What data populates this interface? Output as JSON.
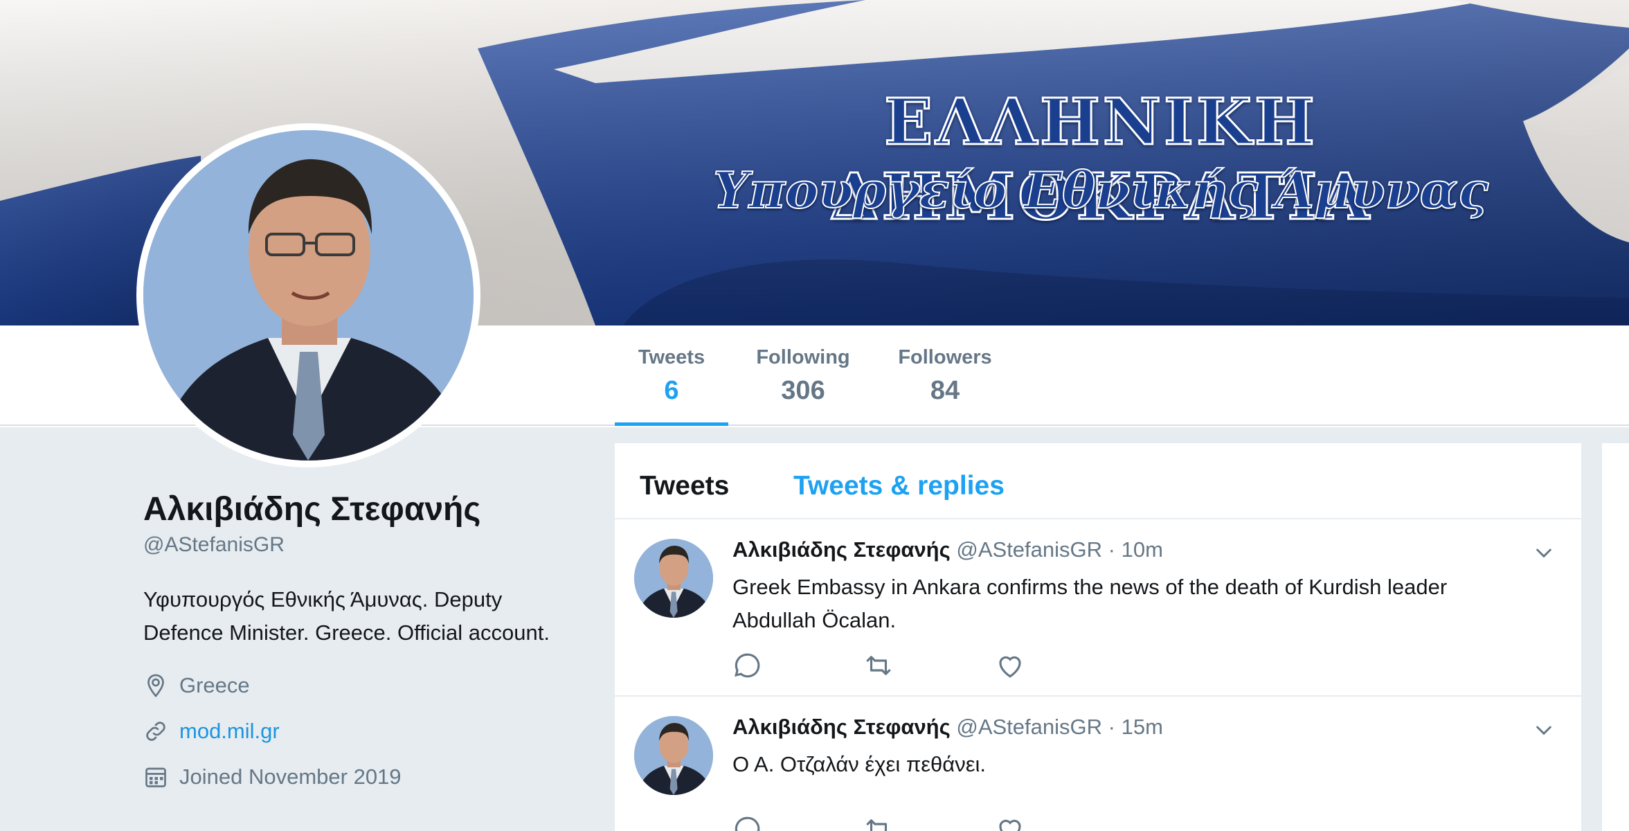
{
  "banner": {
    "title": "ΕΛΛΗΝΙΚΗ ΔΗΜΟΚΡΑΤΙΑ",
    "subtitle": "Υπουργείο Εθνικής Άμυνας",
    "flag_blue": "#1c3e8e"
  },
  "stats": [
    {
      "label": "Tweets",
      "value": "6",
      "active": true
    },
    {
      "label": "Following",
      "value": "306",
      "active": false
    },
    {
      "label": "Followers",
      "value": "84",
      "active": false
    }
  ],
  "profile": {
    "name": "Αλκιβιάδης Στεφανής",
    "handle": "@AStefanisGR",
    "bio": "Υφυπουργός Εθνικής Άμυνας. Deputy Defence Minister. Greece. Official account.",
    "location": "Greece",
    "location_icon": "location-pin-icon",
    "url": "mod.mil.gr",
    "url_icon": "link-icon",
    "joined": "Joined November 2019",
    "joined_icon": "calendar-icon"
  },
  "timeline": {
    "tabs": [
      {
        "label": "Tweets",
        "active": true
      },
      {
        "label": "Tweets & replies",
        "active": false
      }
    ],
    "tweets": [
      {
        "name": "Αλκιβιάδης Στεφανής",
        "handle": "@AStefanisGR",
        "separator": "·",
        "time": "10m",
        "text": "Greek Embassy in Ankara confirms the news of the death of Kurdish leader Abdullah Öcalan."
      },
      {
        "name": "Αλκιβιάδης Στεφανής",
        "handle": "@AStefanisGR",
        "separator": "·",
        "time": "15m",
        "text": "Ο Α. Οτζαλάν έχει πεθάνει."
      }
    ]
  },
  "colors": {
    "accent": "#1da1f2",
    "link": "#1b95e0",
    "muted": "#657786",
    "text": "#14171a",
    "page_bg": "#e6ecf0"
  }
}
